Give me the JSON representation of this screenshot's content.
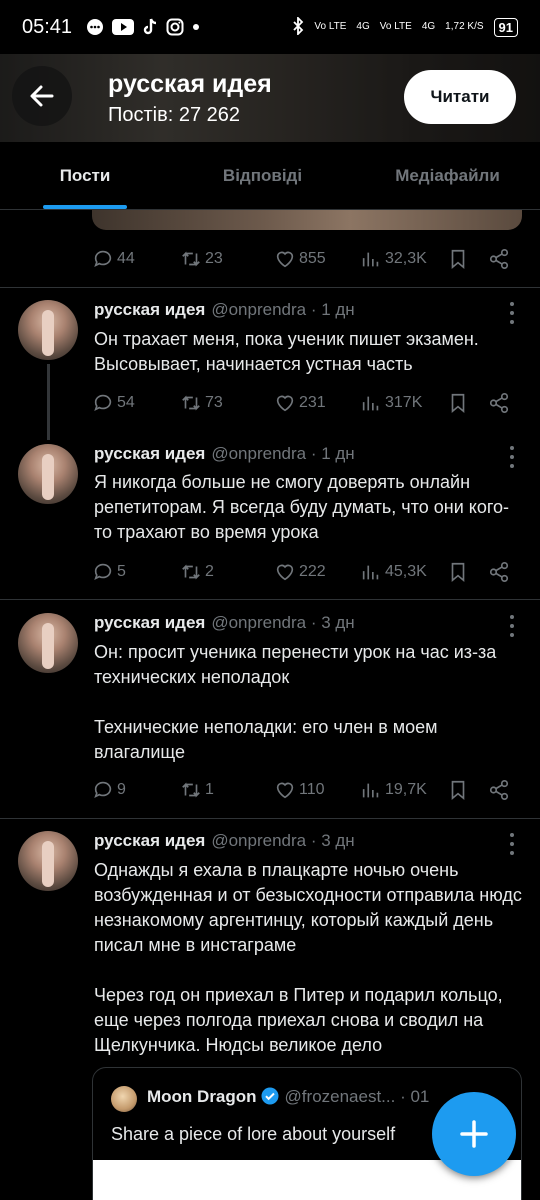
{
  "status": {
    "time": "05:41",
    "net1": "Vo LTE",
    "net2": "4G",
    "net3": "Vo LTE",
    "net4": "4G",
    "speed": "1,72 K/S",
    "battery": "91"
  },
  "header": {
    "title": "русская идея",
    "subtitle": "Постів: 27 262",
    "follow_label": "Читати"
  },
  "tabs": [
    "Пости",
    "Відповіді",
    "Медіафайли"
  ],
  "top_actions": {
    "replies": "44",
    "retweets": "23",
    "likes": "855",
    "views": "32,3K"
  },
  "tweets": [
    {
      "name": "русская идея",
      "handle": "@onprendra · 1 дн",
      "text": "Он трахает меня, пока ученик пишет экзамен.\nВысовывает, начинается устная часть",
      "replies": "54",
      "retweets": "73",
      "likes": "231",
      "views": "317K"
    },
    {
      "name": "русская идея",
      "handle": "@onprendra · 1 дн",
      "text": "Я никогда больше не смогу доверять онлайн репетиторам. Я всегда буду думать, что они кого-то трахают во время урока",
      "replies": "5",
      "retweets": "2",
      "likes": "222",
      "views": "45,3K"
    },
    {
      "name": "русская идея",
      "handle": "@onprendra · 3 дн",
      "text": "Он: просит ученика перенести урок на час из-за технических неполадок\n\nТехнические неполадки: его член в моем влагалище",
      "replies": "9",
      "retweets": "1",
      "likes": "110",
      "views": "19,7K"
    },
    {
      "name": "русская идея",
      "handle": "@onprendra · 3 дн",
      "text": "Однажды я ехала в плацкарте ночью очень возбужденная и от безысходности отправила нюдс незнакомому аргентинцу, который каждый день писал мне в инстаграме\n\nЧерез год он приехал в Питер и подарил кольцо, еще через полгода приехал снова и сводил на Щелкунчика. Нюдсы великое дело"
    }
  ],
  "quote": {
    "name": "Moon Dragon",
    "handle": "@frozenaest... · 01",
    "text": "Share a piece of lore about yourself"
  }
}
